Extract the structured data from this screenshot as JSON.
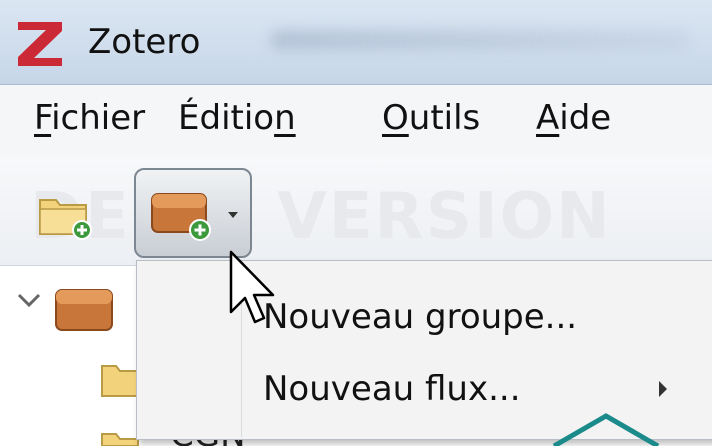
{
  "window": {
    "title": "Zotero",
    "logo_letter": "Z",
    "logo_color": "#cc2936"
  },
  "menubar": {
    "items": [
      {
        "pre": "",
        "key": "F",
        "post": "ichier"
      },
      {
        "pre": "Éditio",
        "key": "n",
        "post": ""
      },
      {
        "pre": "",
        "key": "O",
        "post": "utils"
      },
      {
        "pre": "",
        "key": "A",
        "post": "ide"
      }
    ]
  },
  "toolbar": {
    "watermark": "DEMO VERSION",
    "new_collection_icon": "folder-add-icon",
    "new_library_icon": "library-add-icon"
  },
  "dropdown_menu": {
    "items": [
      {
        "label": "Nouveau groupe..."
      },
      {
        "label": "Nouveau flux...",
        "submenu": true
      }
    ]
  },
  "tree": {
    "partial_text": "CGN"
  },
  "colors": {
    "accent_teal": "#1a8a8a",
    "folder_yellow": "#f2d27a",
    "library_brown": "#c9763a"
  }
}
